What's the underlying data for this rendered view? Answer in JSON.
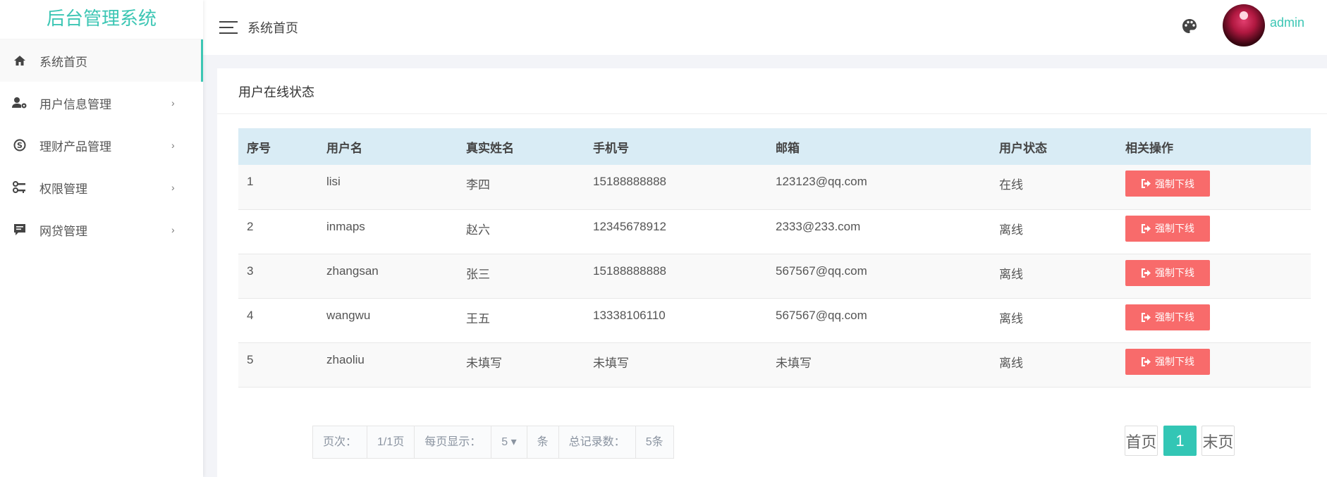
{
  "sidebar": {
    "logo": "后台管理系统",
    "items": [
      {
        "label": "系统首页",
        "icon": "home-icon",
        "active": true
      },
      {
        "label": "用户信息管理",
        "icon": "user-gear-icon"
      },
      {
        "label": "理财产品管理",
        "icon": "skype-s-icon"
      },
      {
        "label": "权限管理",
        "icon": "keys-icon"
      },
      {
        "label": "网贷管理",
        "icon": "message-icon"
      }
    ],
    "chevron": "›"
  },
  "header": {
    "title": "系统首页",
    "username": "admin"
  },
  "card": {
    "title": "用户在线状态"
  },
  "table": {
    "headers": [
      "序号",
      "用户名",
      "真实姓名",
      "手机号",
      "邮箱",
      "用户状态",
      "相关操作"
    ],
    "action_label": "强制下线",
    "rows": [
      [
        "1",
        "lisi",
        "李四",
        "15188888888",
        "123123@qq.com",
        "在线"
      ],
      [
        "2",
        "inmaps",
        "赵六",
        "12345678912",
        "2333@233.com",
        "离线"
      ],
      [
        "3",
        "zhangsan",
        "张三",
        "15188888888",
        "567567@qq.com",
        "离线"
      ],
      [
        "4",
        "wangwu",
        "王五",
        "13338106110",
        "567567@qq.com",
        "离线"
      ],
      [
        "5",
        "zhaoliu",
        "未填写",
        "未填写",
        "未填写",
        "离线"
      ]
    ]
  },
  "pagination": {
    "page_label": "页次：",
    "page_value": "1/1页",
    "per_page_label": "每页显示：",
    "per_page_value": "5 ▾",
    "per_page_unit": "条",
    "total_label": "总记录数：",
    "total_value": "5条",
    "first": "首页",
    "current": "1",
    "last": "末页"
  },
  "colors": {
    "accent": "#3cc6b4",
    "danger": "#f86b6b",
    "table_header": "#d9ecf5"
  }
}
